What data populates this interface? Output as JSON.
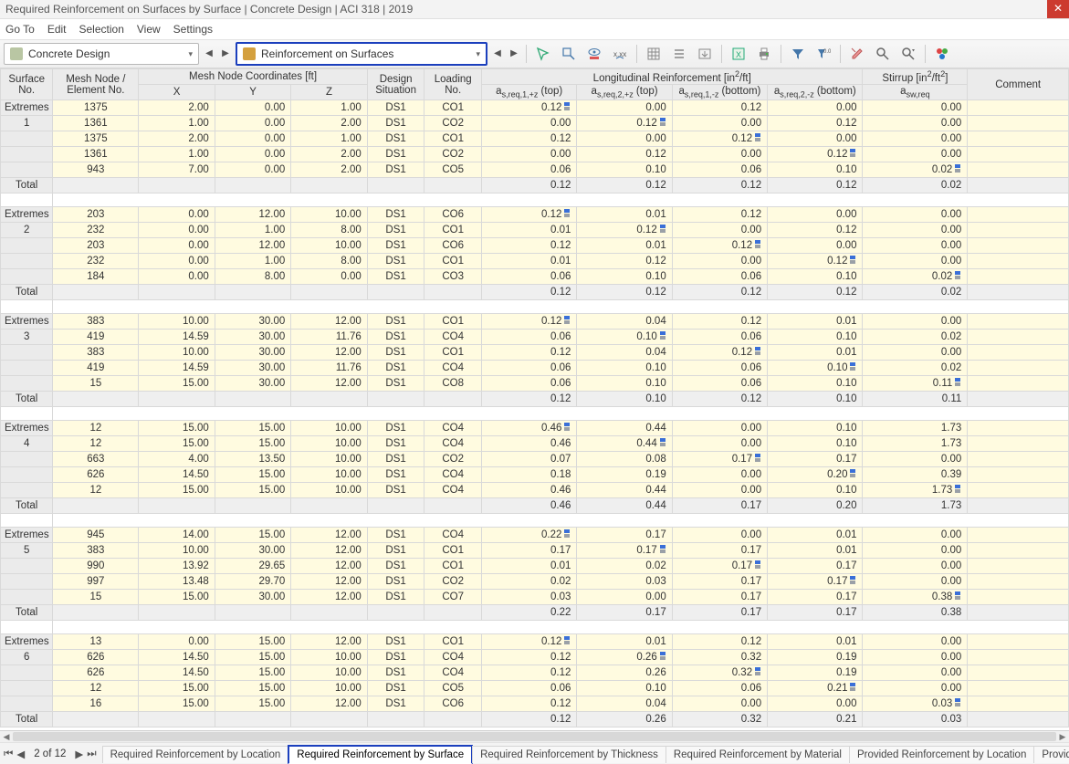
{
  "title": "Required Reinforcement on Surfaces by Surface | Concrete Design | ACI 318 | 2019",
  "menu": {
    "goTo": "Go To",
    "edit": "Edit",
    "selection": "Selection",
    "view": "View",
    "settings": "Settings"
  },
  "toolbar": {
    "combo1": "Concrete Design",
    "combo2": "Reinforcement on Surfaces"
  },
  "headers": {
    "surfaceNo": "Surface\nNo.",
    "meshNode": "Mesh Node /\nElement No.",
    "coordsGroup": "Mesh Node Coordinates [ft]",
    "x": "X",
    "y": "Y",
    "z": "Z",
    "design": "Design\nSituation",
    "loading": "Loading\nNo.",
    "longGroup": "Longitudinal Reinforcement [in²/ft]",
    "c1": "as,req,1,+z (top)",
    "c2": "as,req,2,+z (top)",
    "c3": "as,req,1,-z (bottom)",
    "c4": "as,req,2,-z (bottom)",
    "stirrupGroup": "Stirrup [in²/ft²]",
    "stirrup": "asw,req",
    "comment": "Comment"
  },
  "labels": {
    "extremes": "Extremes",
    "total": "Total"
  },
  "footer": {
    "page": "2 of 12",
    "tabs": {
      "t1": "Required Reinforcement by Location",
      "t2": "Required Reinforcement by Surface",
      "t3": "Required Reinforcement by Thickness",
      "t4": "Required Reinforcement by Material",
      "t5": "Provided Reinforcement by Location",
      "t6": "Provided Reinforcement by"
    }
  },
  "surfaces": [
    {
      "no": "1",
      "rows": [
        {
          "n": "1375",
          "x": "2.00",
          "y": "0.00",
          "z": "1.00",
          "ds": "DS1",
          "co": "CO1",
          "v1": "0.12",
          "i1": true,
          "v2": "0.00",
          "i2": false,
          "v3": "0.12",
          "i3": false,
          "v4": "0.00",
          "i4": false,
          "sw": "0.00",
          "isw": false
        },
        {
          "n": "1361",
          "x": "1.00",
          "y": "0.00",
          "z": "2.00",
          "ds": "DS1",
          "co": "CO2",
          "v1": "0.00",
          "i1": false,
          "v2": "0.12",
          "i2": true,
          "v3": "0.00",
          "i3": false,
          "v4": "0.12",
          "i4": false,
          "sw": "0.00",
          "isw": false
        },
        {
          "n": "1375",
          "x": "2.00",
          "y": "0.00",
          "z": "1.00",
          "ds": "DS1",
          "co": "CO1",
          "v1": "0.12",
          "i1": false,
          "v2": "0.00",
          "i2": false,
          "v3": "0.12",
          "i3": true,
          "v4": "0.00",
          "i4": false,
          "sw": "0.00",
          "isw": false
        },
        {
          "n": "1361",
          "x": "1.00",
          "y": "0.00",
          "z": "2.00",
          "ds": "DS1",
          "co": "CO2",
          "v1": "0.00",
          "i1": false,
          "v2": "0.12",
          "i2": false,
          "v3": "0.00",
          "i3": false,
          "v4": "0.12",
          "i4": true,
          "sw": "0.00",
          "isw": false
        },
        {
          "n": "943",
          "x": "7.00",
          "y": "0.00",
          "z": "2.00",
          "ds": "DS1",
          "co": "CO5",
          "v1": "0.06",
          "i1": false,
          "v2": "0.10",
          "i2": false,
          "v3": "0.06",
          "i3": false,
          "v4": "0.10",
          "i4": false,
          "sw": "0.02",
          "isw": true
        }
      ],
      "total": {
        "v1": "0.12",
        "v2": "0.12",
        "v3": "0.12",
        "v4": "0.12",
        "sw": "0.02"
      }
    },
    {
      "no": "2",
      "rows": [
        {
          "n": "203",
          "x": "0.00",
          "y": "12.00",
          "z": "10.00",
          "ds": "DS1",
          "co": "CO6",
          "v1": "0.12",
          "i1": true,
          "v2": "0.01",
          "i2": false,
          "v3": "0.12",
          "i3": false,
          "v4": "0.00",
          "i4": false,
          "sw": "0.00",
          "isw": false
        },
        {
          "n": "232",
          "x": "0.00",
          "y": "1.00",
          "z": "8.00",
          "ds": "DS1",
          "co": "CO1",
          "v1": "0.01",
          "i1": false,
          "v2": "0.12",
          "i2": true,
          "v3": "0.00",
          "i3": false,
          "v4": "0.12",
          "i4": false,
          "sw": "0.00",
          "isw": false
        },
        {
          "n": "203",
          "x": "0.00",
          "y": "12.00",
          "z": "10.00",
          "ds": "DS1",
          "co": "CO6",
          "v1": "0.12",
          "i1": false,
          "v2": "0.01",
          "i2": false,
          "v3": "0.12",
          "i3": true,
          "v4": "0.00",
          "i4": false,
          "sw": "0.00",
          "isw": false
        },
        {
          "n": "232",
          "x": "0.00",
          "y": "1.00",
          "z": "8.00",
          "ds": "DS1",
          "co": "CO1",
          "v1": "0.01",
          "i1": false,
          "v2": "0.12",
          "i2": false,
          "v3": "0.00",
          "i3": false,
          "v4": "0.12",
          "i4": true,
          "sw": "0.00",
          "isw": false
        },
        {
          "n": "184",
          "x": "0.00",
          "y": "8.00",
          "z": "0.00",
          "ds": "DS1",
          "co": "CO3",
          "v1": "0.06",
          "i1": false,
          "v2": "0.10",
          "i2": false,
          "v3": "0.06",
          "i3": false,
          "v4": "0.10",
          "i4": false,
          "sw": "0.02",
          "isw": true
        }
      ],
      "total": {
        "v1": "0.12",
        "v2": "0.12",
        "v3": "0.12",
        "v4": "0.12",
        "sw": "0.02"
      }
    },
    {
      "no": "3",
      "rows": [
        {
          "n": "383",
          "x": "10.00",
          "y": "30.00",
          "z": "12.00",
          "ds": "DS1",
          "co": "CO1",
          "v1": "0.12",
          "i1": true,
          "v2": "0.04",
          "i2": false,
          "v3": "0.12",
          "i3": false,
          "v4": "0.01",
          "i4": false,
          "sw": "0.00",
          "isw": false
        },
        {
          "n": "419",
          "x": "14.59",
          "y": "30.00",
          "z": "11.76",
          "ds": "DS1",
          "co": "CO4",
          "v1": "0.06",
          "i1": false,
          "v2": "0.10",
          "i2": true,
          "v3": "0.06",
          "i3": false,
          "v4": "0.10",
          "i4": false,
          "sw": "0.02",
          "isw": false
        },
        {
          "n": "383",
          "x": "10.00",
          "y": "30.00",
          "z": "12.00",
          "ds": "DS1",
          "co": "CO1",
          "v1": "0.12",
          "i1": false,
          "v2": "0.04",
          "i2": false,
          "v3": "0.12",
          "i3": true,
          "v4": "0.01",
          "i4": false,
          "sw": "0.00",
          "isw": false
        },
        {
          "n": "419",
          "x": "14.59",
          "y": "30.00",
          "z": "11.76",
          "ds": "DS1",
          "co": "CO4",
          "v1": "0.06",
          "i1": false,
          "v2": "0.10",
          "i2": false,
          "v3": "0.06",
          "i3": false,
          "v4": "0.10",
          "i4": true,
          "sw": "0.02",
          "isw": false
        },
        {
          "n": "15",
          "x": "15.00",
          "y": "30.00",
          "z": "12.00",
          "ds": "DS1",
          "co": "CO8",
          "v1": "0.06",
          "i1": false,
          "v2": "0.10",
          "i2": false,
          "v3": "0.06",
          "i3": false,
          "v4": "0.10",
          "i4": false,
          "sw": "0.11",
          "isw": true
        }
      ],
      "total": {
        "v1": "0.12",
        "v2": "0.10",
        "v3": "0.12",
        "v4": "0.10",
        "sw": "0.11"
      }
    },
    {
      "no": "4",
      "rows": [
        {
          "n": "12",
          "x": "15.00",
          "y": "15.00",
          "z": "10.00",
          "ds": "DS1",
          "co": "CO4",
          "v1": "0.46",
          "i1": true,
          "v2": "0.44",
          "i2": false,
          "v3": "0.00",
          "i3": false,
          "v4": "0.10",
          "i4": false,
          "sw": "1.73",
          "isw": false
        },
        {
          "n": "12",
          "x": "15.00",
          "y": "15.00",
          "z": "10.00",
          "ds": "DS1",
          "co": "CO4",
          "v1": "0.46",
          "i1": false,
          "v2": "0.44",
          "i2": true,
          "v3": "0.00",
          "i3": false,
          "v4": "0.10",
          "i4": false,
          "sw": "1.73",
          "isw": false
        },
        {
          "n": "663",
          "x": "4.00",
          "y": "13.50",
          "z": "10.00",
          "ds": "DS1",
          "co": "CO2",
          "v1": "0.07",
          "i1": false,
          "v2": "0.08",
          "i2": false,
          "v3": "0.17",
          "i3": true,
          "v4": "0.17",
          "i4": false,
          "sw": "0.00",
          "isw": false
        },
        {
          "n": "626",
          "x": "14.50",
          "y": "15.00",
          "z": "10.00",
          "ds": "DS1",
          "co": "CO4",
          "v1": "0.18",
          "i1": false,
          "v2": "0.19",
          "i2": false,
          "v3": "0.00",
          "i3": false,
          "v4": "0.20",
          "i4": true,
          "sw": "0.39",
          "isw": false
        },
        {
          "n": "12",
          "x": "15.00",
          "y": "15.00",
          "z": "10.00",
          "ds": "DS1",
          "co": "CO4",
          "v1": "0.46",
          "i1": false,
          "v2": "0.44",
          "i2": false,
          "v3": "0.00",
          "i3": false,
          "v4": "0.10",
          "i4": false,
          "sw": "1.73",
          "isw": true
        }
      ],
      "total": {
        "v1": "0.46",
        "v2": "0.44",
        "v3": "0.17",
        "v4": "0.20",
        "sw": "1.73"
      }
    },
    {
      "no": "5",
      "rows": [
        {
          "n": "945",
          "x": "14.00",
          "y": "15.00",
          "z": "12.00",
          "ds": "DS1",
          "co": "CO4",
          "v1": "0.22",
          "i1": true,
          "v2": "0.17",
          "i2": false,
          "v3": "0.00",
          "i3": false,
          "v4": "0.01",
          "i4": false,
          "sw": "0.00",
          "isw": false
        },
        {
          "n": "383",
          "x": "10.00",
          "y": "30.00",
          "z": "12.00",
          "ds": "DS1",
          "co": "CO1",
          "v1": "0.17",
          "i1": false,
          "v2": "0.17",
          "i2": true,
          "v3": "0.17",
          "i3": false,
          "v4": "0.01",
          "i4": false,
          "sw": "0.00",
          "isw": false
        },
        {
          "n": "990",
          "x": "13.92",
          "y": "29.65",
          "z": "12.00",
          "ds": "DS1",
          "co": "CO1",
          "v1": "0.01",
          "i1": false,
          "v2": "0.02",
          "i2": false,
          "v3": "0.17",
          "i3": true,
          "v4": "0.17",
          "i4": false,
          "sw": "0.00",
          "isw": false
        },
        {
          "n": "997",
          "x": "13.48",
          "y": "29.70",
          "z": "12.00",
          "ds": "DS1",
          "co": "CO2",
          "v1": "0.02",
          "i1": false,
          "v2": "0.03",
          "i2": false,
          "v3": "0.17",
          "i3": false,
          "v4": "0.17",
          "i4": true,
          "sw": "0.00",
          "isw": false
        },
        {
          "n": "15",
          "x": "15.00",
          "y": "30.00",
          "z": "12.00",
          "ds": "DS1",
          "co": "CO7",
          "v1": "0.03",
          "i1": false,
          "v2": "0.00",
          "i2": false,
          "v3": "0.17",
          "i3": false,
          "v4": "0.17",
          "i4": false,
          "sw": "0.38",
          "isw": true
        }
      ],
      "total": {
        "v1": "0.22",
        "v2": "0.17",
        "v3": "0.17",
        "v4": "0.17",
        "sw": "0.38"
      }
    },
    {
      "no": "6",
      "rows": [
        {
          "n": "13",
          "x": "0.00",
          "y": "15.00",
          "z": "12.00",
          "ds": "DS1",
          "co": "CO1",
          "v1": "0.12",
          "i1": true,
          "v2": "0.01",
          "i2": false,
          "v3": "0.12",
          "i3": false,
          "v4": "0.01",
          "i4": false,
          "sw": "0.00",
          "isw": false
        },
        {
          "n": "626",
          "x": "14.50",
          "y": "15.00",
          "z": "10.00",
          "ds": "DS1",
          "co": "CO4",
          "v1": "0.12",
          "i1": false,
          "v2": "0.26",
          "i2": true,
          "v3": "0.32",
          "i3": false,
          "v4": "0.19",
          "i4": false,
          "sw": "0.00",
          "isw": false
        },
        {
          "n": "626",
          "x": "14.50",
          "y": "15.00",
          "z": "10.00",
          "ds": "DS1",
          "co": "CO4",
          "v1": "0.12",
          "i1": false,
          "v2": "0.26",
          "i2": false,
          "v3": "0.32",
          "i3": true,
          "v4": "0.19",
          "i4": false,
          "sw": "0.00",
          "isw": false
        },
        {
          "n": "12",
          "x": "15.00",
          "y": "15.00",
          "z": "10.00",
          "ds": "DS1",
          "co": "CO5",
          "v1": "0.06",
          "i1": false,
          "v2": "0.10",
          "i2": false,
          "v3": "0.06",
          "i3": false,
          "v4": "0.21",
          "i4": true,
          "sw": "0.00",
          "isw": false
        },
        {
          "n": "16",
          "x": "15.00",
          "y": "15.00",
          "z": "12.00",
          "ds": "DS1",
          "co": "CO6",
          "v1": "0.12",
          "i1": false,
          "v2": "0.04",
          "i2": false,
          "v3": "0.00",
          "i3": false,
          "v4": "0.00",
          "i4": false,
          "sw": "0.03",
          "isw": true
        }
      ],
      "total": {
        "v1": "0.12",
        "v2": "0.26",
        "v3": "0.32",
        "v4": "0.21",
        "sw": "0.03"
      }
    }
  ]
}
